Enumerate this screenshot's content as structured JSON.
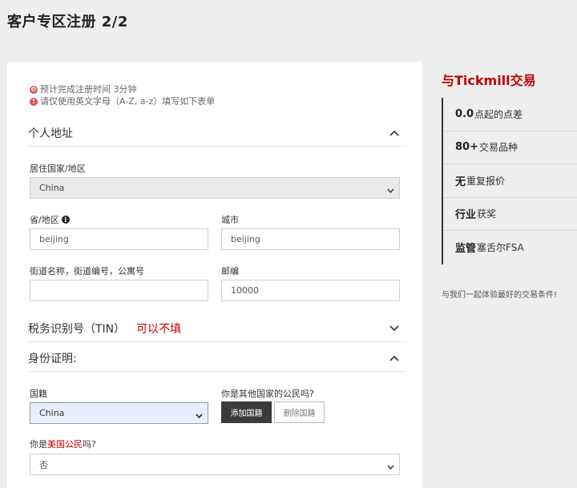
{
  "page": {
    "title": "客户专区注册 2/2"
  },
  "notes": {
    "time": "预计完成注册时间 3分钟",
    "english": "请仅使用英文字母（A-Z, a-z）填写如下表单"
  },
  "sections": {
    "personal_address": "个人地址",
    "tin": "税务识别号（TIN）",
    "tin_note": "可以不填",
    "identity": "身份证明:"
  },
  "fields": {
    "country_label": "居住国家/地区",
    "country_value": "China",
    "province_label": "省/地区",
    "province_value": "beijing",
    "city_label": "城市",
    "city_value": "beijing",
    "street_label": "街道名称，街道编号，公寓号",
    "street_value": "",
    "postcode_label": "邮编",
    "postcode_value": "10000",
    "nationality_label": "国籍",
    "nationality_value": "China",
    "other_citizen_label": "你是其他国家的公民吗?",
    "add_nationality_button": "添加国籍",
    "delete_nationality_button": "删除国籍",
    "us_citizen_label_pre": "你是",
    "us_citizen_label_red": "美国公民",
    "us_citizen_label_post": "吗?",
    "us_citizen_value": "否"
  },
  "sidebar": {
    "title": "与Tickmill交易",
    "items": [
      {
        "bold": "0.0",
        "text": "点起的点差"
      },
      {
        "bold": "80+",
        "text": "交易品种"
      },
      {
        "bold": "无",
        "text": "重复报价"
      },
      {
        "bold": "行业",
        "text": "获奖"
      },
      {
        "bold": "监管",
        "text": " 塞舌尔FSA"
      }
    ],
    "footer": "与我们一起体验最好的交易条件!"
  },
  "colors": {
    "accent": "#c00000",
    "dark_button": "#3b3b3b",
    "page_bg": "#eeeeee"
  },
  "icons": [
    "clock-icon",
    "exclamation-icon",
    "chevron-up-icon",
    "chevron-down-icon",
    "info-icon",
    "caret-down-icon"
  ]
}
